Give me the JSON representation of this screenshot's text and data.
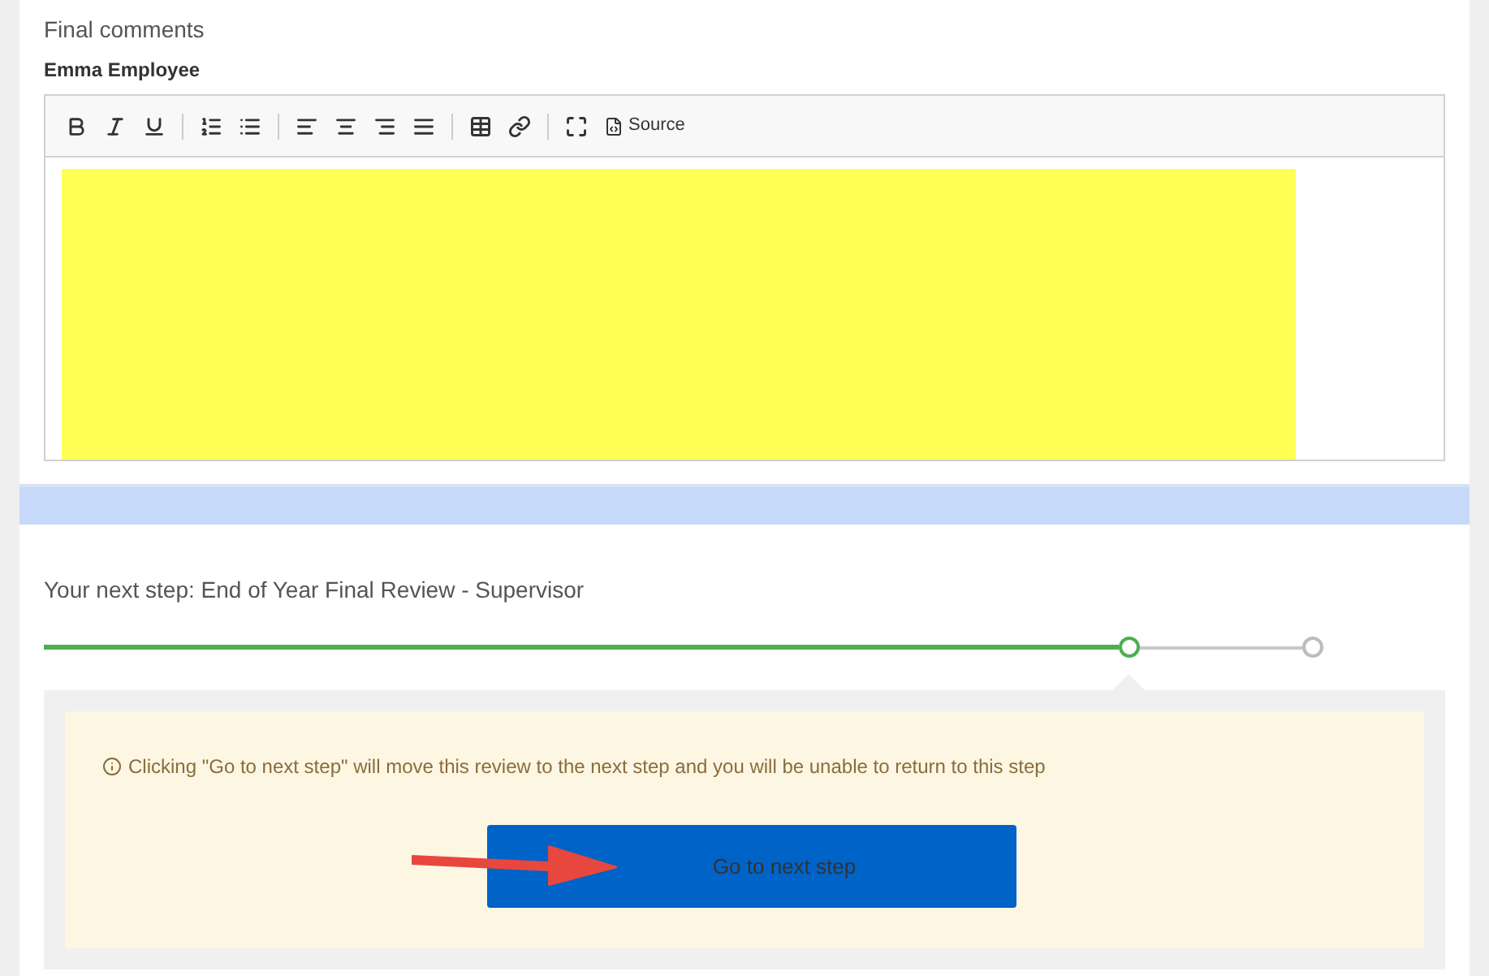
{
  "comments": {
    "title": "Final comments",
    "author": "Emma Employee",
    "toolbar": {
      "source_label": "Source"
    }
  },
  "next_step": {
    "title": "Your next step: End of Year Final Review - Supervisor",
    "markers": [
      {
        "completed": true
      },
      {
        "completed": false
      }
    ],
    "notice": "Clicking \"Go to next step\" will move this review to the next step and you will be unable to return to this step",
    "button": "Go to next step"
  }
}
